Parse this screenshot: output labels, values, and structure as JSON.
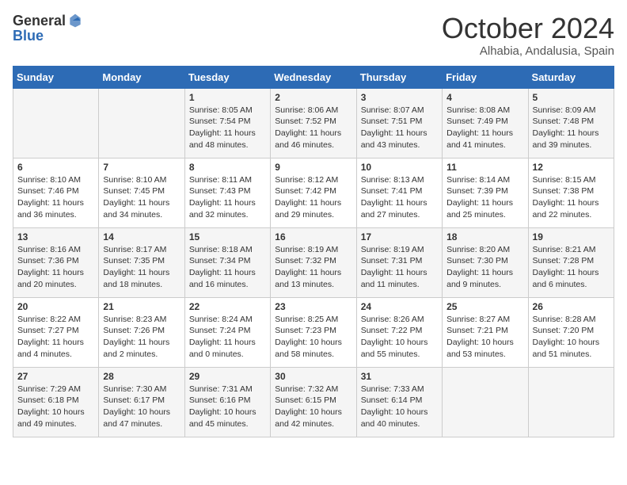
{
  "header": {
    "logo_general": "General",
    "logo_blue": "Blue",
    "month_title": "October 2024",
    "location": "Alhabia, Andalusia, Spain"
  },
  "days_of_week": [
    "Sunday",
    "Monday",
    "Tuesday",
    "Wednesday",
    "Thursday",
    "Friday",
    "Saturday"
  ],
  "weeks": [
    [
      {
        "day": "",
        "sunrise": "",
        "sunset": "",
        "daylight": ""
      },
      {
        "day": "",
        "sunrise": "",
        "sunset": "",
        "daylight": ""
      },
      {
        "day": "1",
        "sunrise": "Sunrise: 8:05 AM",
        "sunset": "Sunset: 7:54 PM",
        "daylight": "Daylight: 11 hours and 48 minutes."
      },
      {
        "day": "2",
        "sunrise": "Sunrise: 8:06 AM",
        "sunset": "Sunset: 7:52 PM",
        "daylight": "Daylight: 11 hours and 46 minutes."
      },
      {
        "day": "3",
        "sunrise": "Sunrise: 8:07 AM",
        "sunset": "Sunset: 7:51 PM",
        "daylight": "Daylight: 11 hours and 43 minutes."
      },
      {
        "day": "4",
        "sunrise": "Sunrise: 8:08 AM",
        "sunset": "Sunset: 7:49 PM",
        "daylight": "Daylight: 11 hours and 41 minutes."
      },
      {
        "day": "5",
        "sunrise": "Sunrise: 8:09 AM",
        "sunset": "Sunset: 7:48 PM",
        "daylight": "Daylight: 11 hours and 39 minutes."
      }
    ],
    [
      {
        "day": "6",
        "sunrise": "Sunrise: 8:10 AM",
        "sunset": "Sunset: 7:46 PM",
        "daylight": "Daylight: 11 hours and 36 minutes."
      },
      {
        "day": "7",
        "sunrise": "Sunrise: 8:10 AM",
        "sunset": "Sunset: 7:45 PM",
        "daylight": "Daylight: 11 hours and 34 minutes."
      },
      {
        "day": "8",
        "sunrise": "Sunrise: 8:11 AM",
        "sunset": "Sunset: 7:43 PM",
        "daylight": "Daylight: 11 hours and 32 minutes."
      },
      {
        "day": "9",
        "sunrise": "Sunrise: 8:12 AM",
        "sunset": "Sunset: 7:42 PM",
        "daylight": "Daylight: 11 hours and 29 minutes."
      },
      {
        "day": "10",
        "sunrise": "Sunrise: 8:13 AM",
        "sunset": "Sunset: 7:41 PM",
        "daylight": "Daylight: 11 hours and 27 minutes."
      },
      {
        "day": "11",
        "sunrise": "Sunrise: 8:14 AM",
        "sunset": "Sunset: 7:39 PM",
        "daylight": "Daylight: 11 hours and 25 minutes."
      },
      {
        "day": "12",
        "sunrise": "Sunrise: 8:15 AM",
        "sunset": "Sunset: 7:38 PM",
        "daylight": "Daylight: 11 hours and 22 minutes."
      }
    ],
    [
      {
        "day": "13",
        "sunrise": "Sunrise: 8:16 AM",
        "sunset": "Sunset: 7:36 PM",
        "daylight": "Daylight: 11 hours and 20 minutes."
      },
      {
        "day": "14",
        "sunrise": "Sunrise: 8:17 AM",
        "sunset": "Sunset: 7:35 PM",
        "daylight": "Daylight: 11 hours and 18 minutes."
      },
      {
        "day": "15",
        "sunrise": "Sunrise: 8:18 AM",
        "sunset": "Sunset: 7:34 PM",
        "daylight": "Daylight: 11 hours and 16 minutes."
      },
      {
        "day": "16",
        "sunrise": "Sunrise: 8:19 AM",
        "sunset": "Sunset: 7:32 PM",
        "daylight": "Daylight: 11 hours and 13 minutes."
      },
      {
        "day": "17",
        "sunrise": "Sunrise: 8:19 AM",
        "sunset": "Sunset: 7:31 PM",
        "daylight": "Daylight: 11 hours and 11 minutes."
      },
      {
        "day": "18",
        "sunrise": "Sunrise: 8:20 AM",
        "sunset": "Sunset: 7:30 PM",
        "daylight": "Daylight: 11 hours and 9 minutes."
      },
      {
        "day": "19",
        "sunrise": "Sunrise: 8:21 AM",
        "sunset": "Sunset: 7:28 PM",
        "daylight": "Daylight: 11 hours and 6 minutes."
      }
    ],
    [
      {
        "day": "20",
        "sunrise": "Sunrise: 8:22 AM",
        "sunset": "Sunset: 7:27 PM",
        "daylight": "Daylight: 11 hours and 4 minutes."
      },
      {
        "day": "21",
        "sunrise": "Sunrise: 8:23 AM",
        "sunset": "Sunset: 7:26 PM",
        "daylight": "Daylight: 11 hours and 2 minutes."
      },
      {
        "day": "22",
        "sunrise": "Sunrise: 8:24 AM",
        "sunset": "Sunset: 7:24 PM",
        "daylight": "Daylight: 11 hours and 0 minutes."
      },
      {
        "day": "23",
        "sunrise": "Sunrise: 8:25 AM",
        "sunset": "Sunset: 7:23 PM",
        "daylight": "Daylight: 10 hours and 58 minutes."
      },
      {
        "day": "24",
        "sunrise": "Sunrise: 8:26 AM",
        "sunset": "Sunset: 7:22 PM",
        "daylight": "Daylight: 10 hours and 55 minutes."
      },
      {
        "day": "25",
        "sunrise": "Sunrise: 8:27 AM",
        "sunset": "Sunset: 7:21 PM",
        "daylight": "Daylight: 10 hours and 53 minutes."
      },
      {
        "day": "26",
        "sunrise": "Sunrise: 8:28 AM",
        "sunset": "Sunset: 7:20 PM",
        "daylight": "Daylight: 10 hours and 51 minutes."
      }
    ],
    [
      {
        "day": "27",
        "sunrise": "Sunrise: 7:29 AM",
        "sunset": "Sunset: 6:18 PM",
        "daylight": "Daylight: 10 hours and 49 minutes."
      },
      {
        "day": "28",
        "sunrise": "Sunrise: 7:30 AM",
        "sunset": "Sunset: 6:17 PM",
        "daylight": "Daylight: 10 hours and 47 minutes."
      },
      {
        "day": "29",
        "sunrise": "Sunrise: 7:31 AM",
        "sunset": "Sunset: 6:16 PM",
        "daylight": "Daylight: 10 hours and 45 minutes."
      },
      {
        "day": "30",
        "sunrise": "Sunrise: 7:32 AM",
        "sunset": "Sunset: 6:15 PM",
        "daylight": "Daylight: 10 hours and 42 minutes."
      },
      {
        "day": "31",
        "sunrise": "Sunrise: 7:33 AM",
        "sunset": "Sunset: 6:14 PM",
        "daylight": "Daylight: 10 hours and 40 minutes."
      },
      {
        "day": "",
        "sunrise": "",
        "sunset": "",
        "daylight": ""
      },
      {
        "day": "",
        "sunrise": "",
        "sunset": "",
        "daylight": ""
      }
    ]
  ]
}
